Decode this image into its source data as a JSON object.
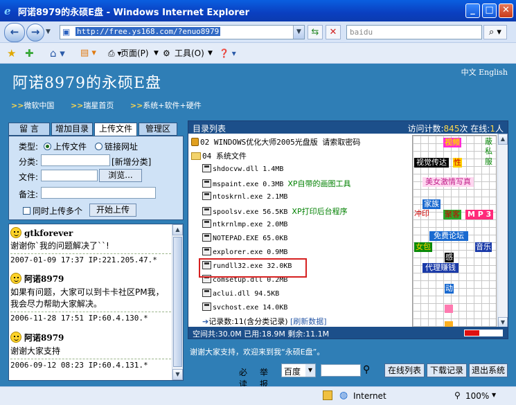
{
  "window": {
    "title": "阿诺8979的永硕E盘 - Windows Internet Explorer"
  },
  "address": {
    "url": "http://free.ys168.com/?enuo8979",
    "search_placeholder": "baidu"
  },
  "toolbar": {
    "page_label": "页面(P)",
    "tools_label": "工具(O)"
  },
  "site": {
    "title": "阿诺8979的永硕E盘",
    "lang_zh": "中文",
    "lang_en": "English",
    "nav": [
      "微软中国",
      "瑞星首页",
      "系统+软件+硬件"
    ]
  },
  "tabs": [
    "留 言",
    "增加目录",
    "上传文件",
    "管理区"
  ],
  "upload": {
    "type_label": "类型:",
    "opt_file": "上传文件",
    "opt_link": "链接网址",
    "cat_label": "分类:",
    "new_cat": "[新增分类]",
    "file_label": "文件:",
    "browse": "浏览...",
    "note_label": "备注:",
    "multi": "同时上传多个",
    "start": "开始上传"
  },
  "messages": [
    {
      "name": "gtkforever",
      "text": "谢谢你`我的问题解决了``!",
      "meta": "2007-01-09 17:37 IP:221.205.47.*"
    },
    {
      "name": "阿诺8979",
      "text": "如果有问题，大家可以到卡卡社区PM我，我会尽力帮助大家解决。",
      "meta": "2006-11-28 17:51 IP:60.4.130.*"
    },
    {
      "name": "阿诺8979",
      "text": "谢谢大家支持",
      "meta": "2006-09-12 08:23 IP:60.4.131.*"
    }
  ],
  "dir": {
    "title": "目录列表",
    "visits_label": "访问计数:",
    "visits": "845",
    "visits_unit": "次",
    "online_label": "在线:",
    "online": "1",
    "online_unit": "人",
    "folder1": "02 WINDOWS优化大师2005光盘版 请索取密码",
    "folder2": "04 系统文件",
    "files": [
      {
        "name": "shdocvw.dll 1.4MB",
        "desc": ""
      },
      {
        "name": "mspaint.exe 0.3MB",
        "desc": "XP自带的画图工具"
      },
      {
        "name": "ntoskrnl.exe 2.1MB",
        "desc": ""
      },
      {
        "name": "spoolsv.exe 56.5KB",
        "desc": "XP打印后台程序"
      },
      {
        "name": "ntkrnlmp.exe 2.0MB",
        "desc": ""
      },
      {
        "name": "NOTEPAD.EXE 65.0KB",
        "desc": ""
      },
      {
        "name": "explorer.exe 0.9MB",
        "desc": ""
      },
      {
        "name": "rundll32.exe 32.0KB",
        "desc": ""
      },
      {
        "name": "comsetup.dll 0.2MB",
        "desc": ""
      },
      {
        "name": "aclui.dll 94.5KB",
        "desc": ""
      },
      {
        "name": "svchost.exe 14.0KB",
        "desc": ""
      }
    ],
    "records": "记录数:11(含分类记录)",
    "refresh": "[刷新数据]",
    "footer": "空间共:30.0M 已用:18.9M 剩余:11.1M"
  },
  "ads": [
    "视频",
    "蔽",
    "私",
    "服",
    "视觉传达",
    "性",
    "美女激情写真",
    "家族",
    "冲印",
    "聚客",
    "M P 3",
    "免费论坛",
    "女包",
    "音乐",
    "感",
    "代理赚钱",
    "动"
  ],
  "bottom": {
    "thanks": "谢谢大家支持，欢迎来到我“永硕E盘”。",
    "must": "必读",
    "report": "举报",
    "engine": "百度",
    "btn_online": "在线列表",
    "btn_download": "下载记录",
    "btn_exit": "退出系统"
  },
  "status": {
    "zone": "Internet",
    "zoom": "100%"
  }
}
